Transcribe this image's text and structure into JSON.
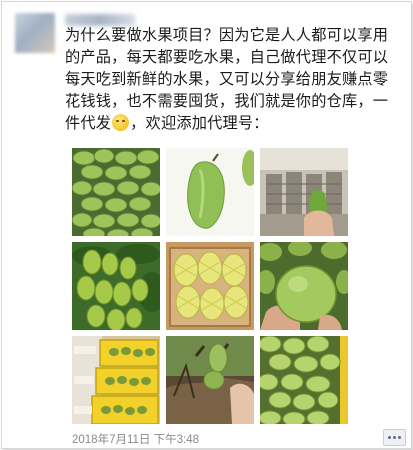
{
  "post": {
    "author_name": "",
    "text_main": "为什么要做水果项目？因为它是人人都可以享用的产品，每天都要吃水果，自己做代理不仅可以每天吃到新鲜的水果，又可以分享给朋友赚点零花钱钱，也不需要囤货，我们就是你的仓库，一件代发",
    "text_tail": "，欢迎添加代理号：",
    "emoji": "smirk-face",
    "timestamp": "2018年7月11日  下午3:48"
  },
  "images": [
    {
      "name": "mango-pile-image"
    },
    {
      "name": "single-mango-image"
    },
    {
      "name": "warehouse-mango-hand-image"
    },
    {
      "name": "mango-tree-image"
    },
    {
      "name": "wrapped-mangoes-box-image"
    },
    {
      "name": "mango-in-hand-image"
    },
    {
      "name": "mango-crates-image"
    },
    {
      "name": "mango-branch-hand-image"
    },
    {
      "name": "mango-pile-closeup-image"
    }
  ],
  "colors": {
    "text": "#1a1a1a",
    "timestamp": "#8a8a8a",
    "mango_green": "#8fb84a",
    "crate_yellow": "#e3c62a"
  }
}
